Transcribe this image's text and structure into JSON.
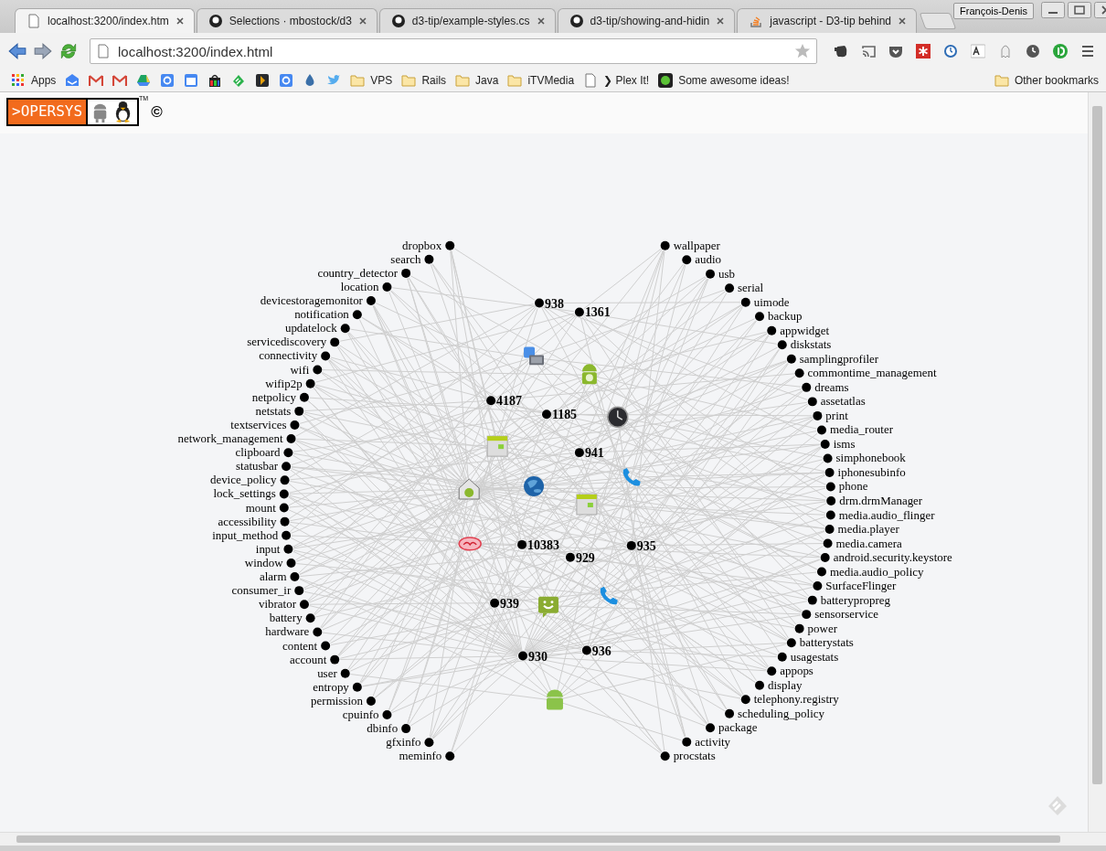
{
  "window": {
    "user": "François-Denis"
  },
  "tabs": [
    {
      "kind": "page",
      "title": "localhost:3200/index.htm",
      "selected": true
    },
    {
      "kind": "github",
      "title": "Selections · mbostock/d3",
      "selected": false
    },
    {
      "kind": "github",
      "title": "d3-tip/example-styles.cs",
      "selected": false
    },
    {
      "kind": "github",
      "title": "d3-tip/showing-and-hidin",
      "selected": false
    },
    {
      "kind": "stack",
      "title": "javascript - D3-tip behind",
      "selected": false
    }
  ],
  "address_bar": {
    "url": "localhost:3200/index.html"
  },
  "bookmarks": [
    {
      "kind": "apps",
      "label": "Apps"
    },
    {
      "kind": "icon"
    },
    {
      "kind": "icon"
    },
    {
      "kind": "icon"
    },
    {
      "kind": "icon"
    },
    {
      "kind": "icon"
    },
    {
      "kind": "icon"
    },
    {
      "kind": "icon"
    },
    {
      "kind": "icon"
    },
    {
      "kind": "icon"
    },
    {
      "kind": "icon"
    },
    {
      "kind": "icon"
    },
    {
      "kind": "icon"
    },
    {
      "kind": "folder",
      "label": "VPS"
    },
    {
      "kind": "folder",
      "label": "Rails"
    },
    {
      "kind": "folder",
      "label": "Java"
    },
    {
      "kind": "folder",
      "label": "iTVMedia"
    },
    {
      "kind": "page",
      "label": "❯ Plex It!"
    },
    {
      "kind": "site",
      "label": "Some awesome ideas!"
    }
  ],
  "other_bookmarks": {
    "label": "Other bookmarks"
  },
  "logo": {
    "text": ">OPERSYS",
    "trademark": "TM",
    "copyright": "©"
  },
  "graph": {
    "left_services": [
      "dropbox",
      "search",
      "country_detector",
      "location",
      "devicestoragemonitor",
      "notification",
      "updatelock",
      "servicediscovery",
      "connectivity",
      "wifi",
      "wifip2p",
      "netpolicy",
      "netstats",
      "textservices",
      "network_management",
      "clipboard",
      "statusbar",
      "device_policy",
      "lock_settings",
      "mount",
      "accessibility",
      "input_method",
      "input",
      "window",
      "alarm",
      "consumer_ir",
      "vibrator",
      "battery",
      "hardware",
      "content",
      "account",
      "user",
      "entropy",
      "permission",
      "cpuinfo",
      "dbinfo",
      "gfxinfo",
      "meminfo"
    ],
    "right_services": [
      "wallpaper",
      "audio",
      "usb",
      "serial",
      "uimode",
      "backup",
      "appwidget",
      "diskstats",
      "samplingprofiler",
      "commontime_management",
      "dreams",
      "assetatlas",
      "print",
      "media_router",
      "isms",
      "simphonebook",
      "iphonesubinfo",
      "phone",
      "drm.drmManager",
      "media.audio_flinger",
      "media.player",
      "media.camera",
      "android.security.keystore",
      "media.audio_policy",
      "SurfaceFlinger",
      "batterypropreg",
      "sensorservice",
      "power",
      "batterystats",
      "usagestats",
      "appops",
      "display",
      "telephony.registry",
      "scheduling_policy",
      "package",
      "activity",
      "procstats"
    ],
    "center_nodes": [
      {
        "kind": "process",
        "label": "938"
      },
      {
        "kind": "process",
        "label": "1361"
      },
      {
        "kind": "app"
      },
      {
        "kind": "app"
      },
      {
        "kind": "process",
        "label": "4187"
      },
      {
        "kind": "process",
        "label": "1185"
      },
      {
        "kind": "app"
      },
      {
        "kind": "app"
      },
      {
        "kind": "process",
        "label": "941"
      },
      {
        "kind": "app"
      },
      {
        "kind": "app"
      },
      {
        "kind": "app"
      },
      {
        "kind": "app"
      },
      {
        "kind": "app"
      },
      {
        "kind": "process",
        "label": "10383"
      },
      {
        "kind": "process",
        "label": "935"
      },
      {
        "kind": "process",
        "label": "929"
      },
      {
        "kind": "app"
      },
      {
        "kind": "process",
        "label": "939"
      },
      {
        "kind": "app"
      },
      {
        "kind": "process",
        "label": "936"
      },
      {
        "kind": "process",
        "label": "930"
      },
      {
        "kind": "app"
      }
    ]
  }
}
